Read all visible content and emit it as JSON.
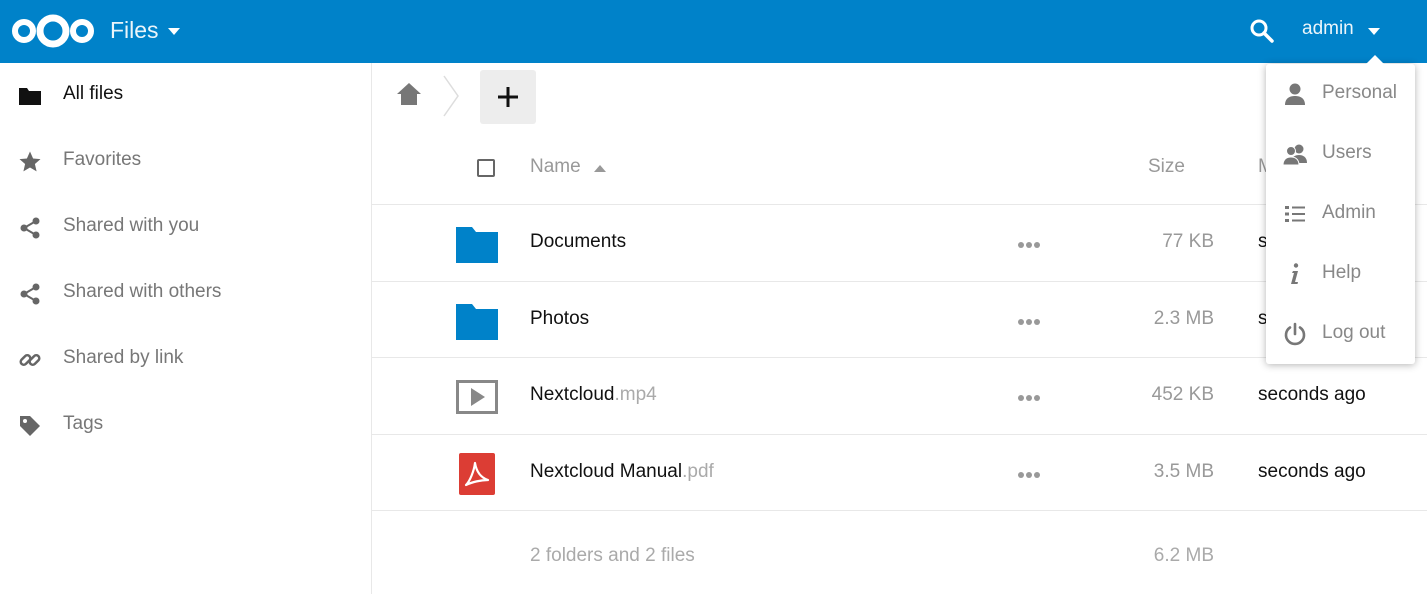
{
  "header": {
    "app_name": "Files",
    "user_name": "admin",
    "brand_color": "#0082c9"
  },
  "sidebar": {
    "items": [
      {
        "label": "All files",
        "icon": "folder-icon",
        "active": true
      },
      {
        "label": "Favorites",
        "icon": "star-icon"
      },
      {
        "label": "Shared with you",
        "icon": "share-icon"
      },
      {
        "label": "Shared with others",
        "icon": "share-icon"
      },
      {
        "label": "Shared by link",
        "icon": "link-icon"
      },
      {
        "label": "Tags",
        "icon": "tag-icon"
      }
    ]
  },
  "table": {
    "columns": {
      "name": "Name",
      "size": "Size",
      "modified": "M"
    },
    "rows": [
      {
        "name": "Documents",
        "ext": "",
        "type": "folder",
        "size": "77 KB",
        "modified": "se"
      },
      {
        "name": "Photos",
        "ext": "",
        "type": "folder",
        "size": "2.3 MB",
        "modified": "s"
      },
      {
        "name": "Nextcloud",
        "ext": ".mp4",
        "type": "video",
        "size": "452 KB",
        "modified": "seconds ago"
      },
      {
        "name": "Nextcloud Manual",
        "ext": ".pdf",
        "type": "pdf",
        "size": "3.5 MB",
        "modified": "seconds ago"
      }
    ],
    "summary": {
      "text": "2 folders and 2 files",
      "size": "6.2 MB"
    }
  },
  "user_menu": {
    "items": [
      {
        "label": "Personal",
        "icon": "person-icon"
      },
      {
        "label": "Users",
        "icon": "users-icon"
      },
      {
        "label": "Admin",
        "icon": "admin-list-icon"
      },
      {
        "label": "Help",
        "icon": "info-icon"
      },
      {
        "label": "Log out",
        "icon": "power-icon"
      }
    ]
  }
}
